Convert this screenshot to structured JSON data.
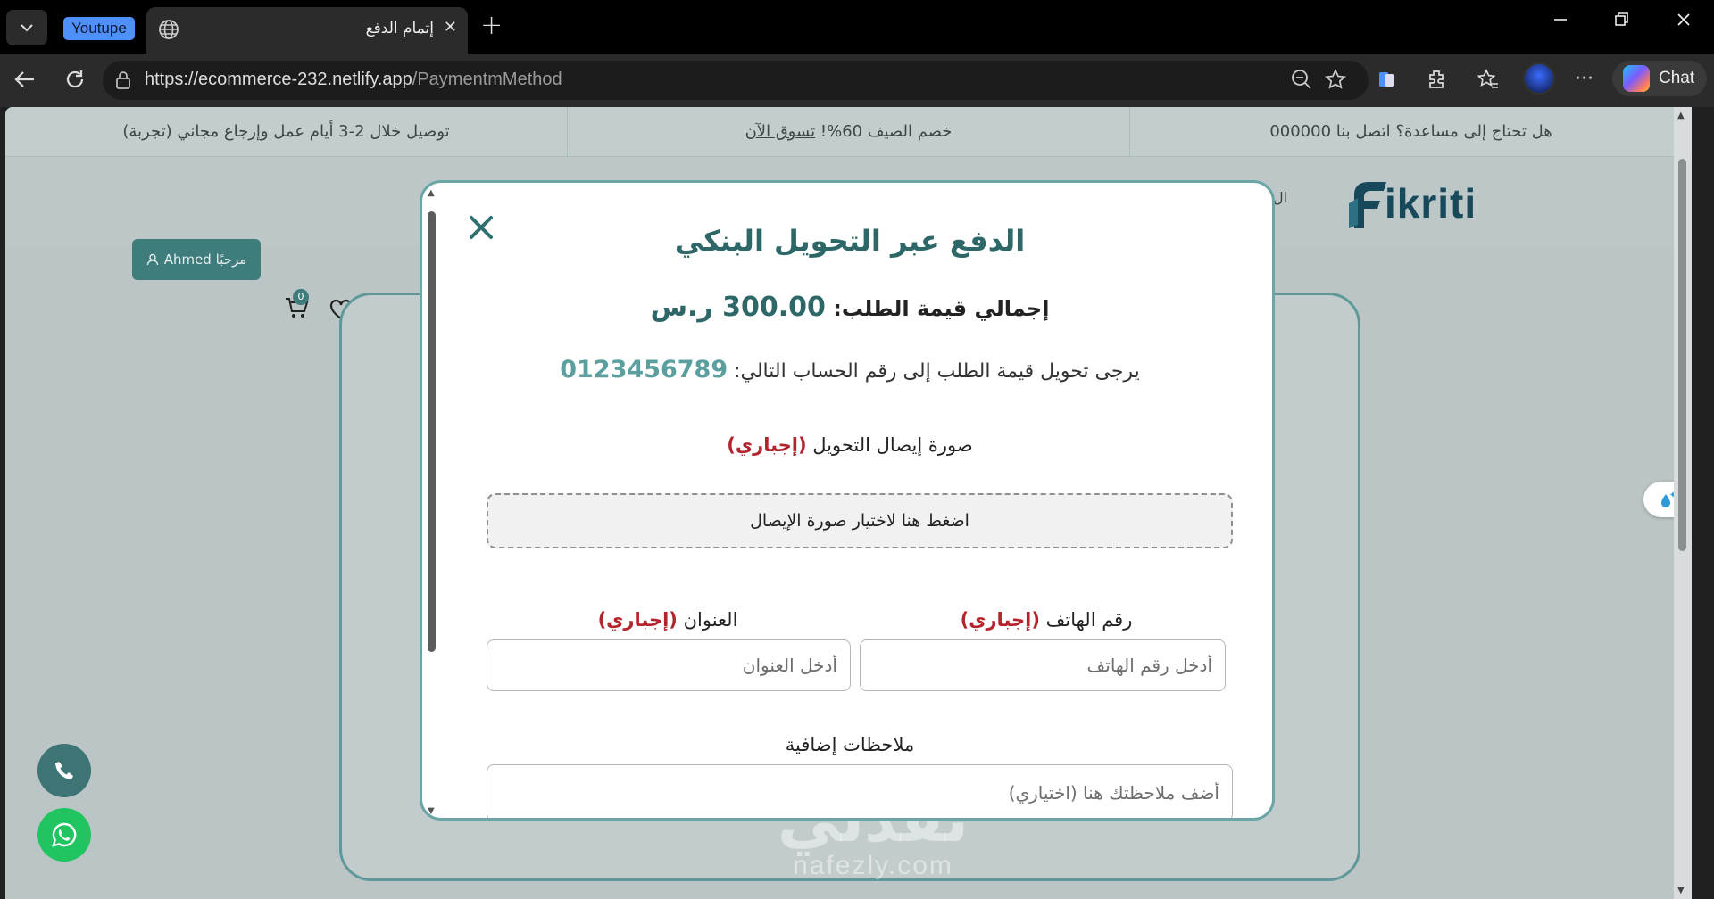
{
  "browser": {
    "tab_group_label": "Youtupe",
    "tab_title": "إتمام الدفع",
    "url_host": "https://ecommerce-232.netlify.app",
    "url_path": "/PaymentmMethod",
    "chat_label": "Chat"
  },
  "announcement_bar": {
    "items": [
      "هل تحتاج إلى مساعدة؟ اتصل بنا 000000",
      "خصم الصيف 60%!",
      "تسوق الآن",
      "توصيل خلال 2-3 أيام عمل وإرجاع مجاني (تجربة)"
    ]
  },
  "header": {
    "logo_text": "ikriti",
    "nav_fragment": "ال",
    "welcome_label": "مرحبًا Ahmed",
    "cart_count": "0"
  },
  "modal": {
    "title": "الدفع عبر التحويل البنكي",
    "total_label": "إجمالي قيمة الطلب:",
    "total_amount": "300.00 ر.س",
    "instruction": "يرجى تحويل قيمة الطلب إلى رقم الحساب التالي:",
    "account_number": "0123456789",
    "receipt_label": "صورة إيصال التحويل",
    "required_tag": "(إجباري)",
    "upload_prompt": "اضغط هنا لاختيار صورة الإيصال",
    "phone_label": "رقم الهاتف",
    "phone_placeholder": "أدخل رقم الهاتف",
    "address_label": "العنوان",
    "address_placeholder": "أدخل العنوان",
    "notes_label": "ملاحظات إضافية",
    "notes_placeholder": "أضف ملاحظتك هنا (اختياري)"
  },
  "watermark": {
    "arabic": "نفذلي",
    "latin": "nafezly.com"
  },
  "colors": {
    "brand_teal": "#2e6767",
    "accent_teal": "#5b9f9f",
    "required_red": "#b3252c",
    "whatsapp_green": "#20c561"
  },
  "icons": [
    "tab-list-icon",
    "globe-icon",
    "close-icon",
    "plus-icon",
    "minimize-icon",
    "restore-icon",
    "back-icon",
    "refresh-icon",
    "lock-icon",
    "zoom-out-icon",
    "star-icon",
    "collections-icon",
    "extensions-icon",
    "favorites-icon",
    "more-icon",
    "copilot-icon",
    "user-icon",
    "cart-icon",
    "heart-icon",
    "phone-icon",
    "whatsapp-icon",
    "assistant-icon"
  ]
}
